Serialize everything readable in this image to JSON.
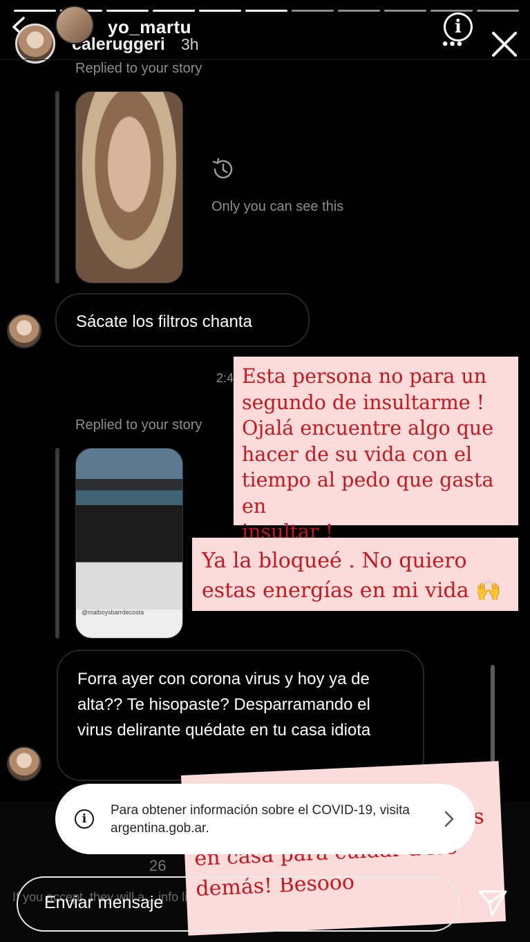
{
  "story": {
    "username": "yo_martu",
    "progress_segments": 11,
    "info_icon": "info-icon",
    "menu_icon": "more-dots-icon",
    "close_icon": "close-icon"
  },
  "dm": {
    "username": "caleruggeri",
    "time": "3h",
    "replied_label_1": "Replied to your story",
    "only_you": "Only you can see this",
    "message_1": "Sácate los filtros chanta",
    "timestamp_partial": "2:4",
    "replied_label_2": "Replied to your story",
    "thumb2_caption": "@malboysbarrdecosta",
    "message_2": "Forra ayer con corona virus y hoy ya de alta?? Te hisopaste? Desparramando el virus delirante quédate en tu casa idiota",
    "faint_count": "26",
    "faint_text": "If you accept, they will a... info like your Activity S..."
  },
  "notes": {
    "note1": "Esta persona no para un\nsegundo de insultarme !\nOjalá encuentre algo que\nhacer de su vida con el\ntiempo al pedo que gasta en\ninsultar !",
    "note2": "Ya la bloqueé .  No quiero\nestas energías en mi vida 🙌",
    "note3": "en casa para cuidar a los\ndemás! Besooo",
    "note3_hidden_fragment": "s"
  },
  "covid_card": {
    "text": "Para obtener información sobre el COVID-19, visita argentina.gob.ar.",
    "icon": "info-icon",
    "chevron": "chevron-right-icon"
  },
  "composer": {
    "placeholder": "Enviar mensaje",
    "send_icon": "send-icon"
  },
  "colors": {
    "note_bg": "#fbdcdb",
    "note_text": "#c8171d",
    "background": "#000000"
  }
}
